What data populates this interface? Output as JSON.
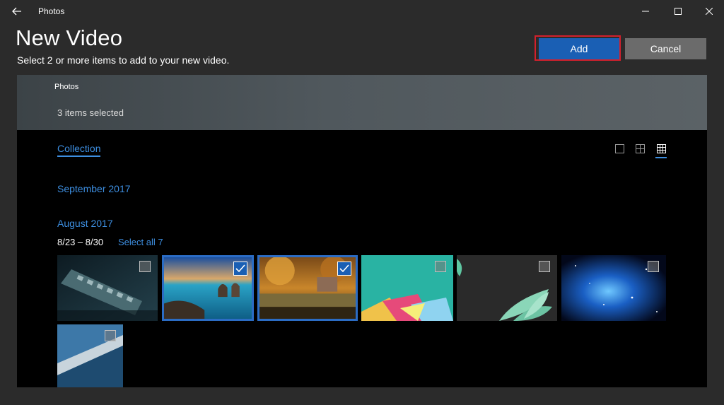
{
  "titlebar": {
    "app_name": "Photos",
    "back_icon": "back-arrow-icon",
    "minimize_icon": "minimize-icon",
    "maximize_icon": "maximize-icon",
    "close_icon": "close-icon"
  },
  "header": {
    "title": "New Video",
    "subtitle": "Select 2 or more items to add to your new video.",
    "add_label": "Add",
    "cancel_label": "Cancel"
  },
  "colors": {
    "accent": "#3d8ee0",
    "add_button": "#1a5fb4",
    "highlight_outline": "#d3202c",
    "cancel_button": "#6b6b6b",
    "background": "#2b2b2b"
  },
  "selection_bar": {
    "title": "Photos",
    "selected_text": "3 items selected"
  },
  "collection": {
    "tab_label": "Collection",
    "view_icons": [
      "large-tile-view-icon",
      "medium-tile-view-icon",
      "small-tile-view-icon"
    ],
    "groups": [
      {
        "label": "September 2017"
      },
      {
        "label": "August 2017",
        "date_range": "8/23 – 8/30",
        "select_all_label": "Select all 7"
      }
    ],
    "items": [
      {
        "name": "memory-module-photo",
        "selected": false
      },
      {
        "name": "sea-rocks-photo",
        "selected": true
      },
      {
        "name": "autumn-trees-photo",
        "selected": true
      },
      {
        "name": "teal-geometric-wallpaper",
        "selected": false
      },
      {
        "name": "leaf-fronds-wallpaper",
        "selected": false
      },
      {
        "name": "blue-nebula-wallpaper",
        "selected": false
      },
      {
        "name": "blue-abstract-wallpaper",
        "selected": false
      }
    ]
  }
}
